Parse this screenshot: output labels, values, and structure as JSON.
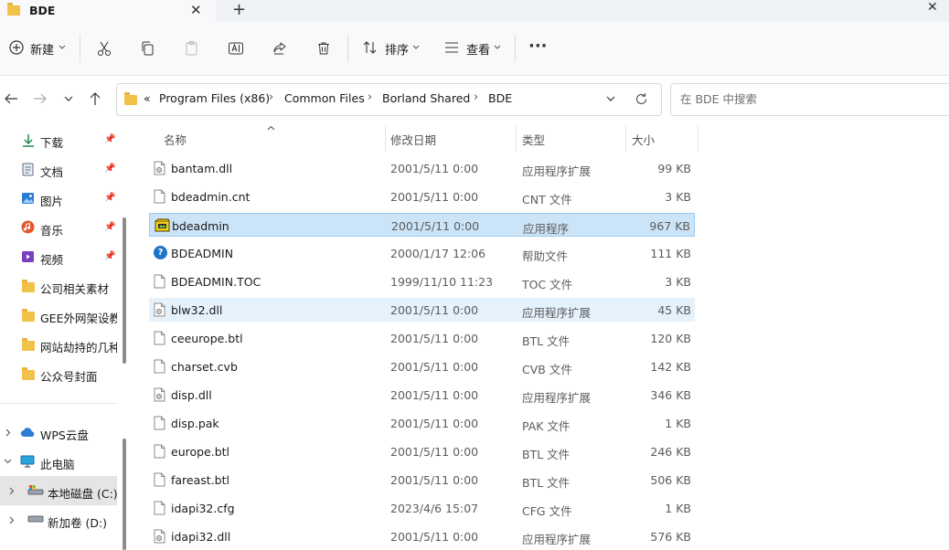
{
  "window": {
    "tab_title": "BDE",
    "tab_close": "✕",
    "new_tab": "+",
    "close": "✕"
  },
  "toolbar": {
    "new_label": "新建",
    "sort_label": "排序",
    "view_label": "查看",
    "more": "···"
  },
  "address": {
    "overflow": "«",
    "crumbs": [
      "Program Files (x86)",
      "Common Files",
      "Borland Shared",
      "BDE"
    ],
    "separator": "›"
  },
  "search": {
    "placeholder": "在 BDE 中搜索"
  },
  "sidebar": {
    "quick_access": [
      {
        "label": "下载",
        "icon": "download-icon"
      },
      {
        "label": "文档",
        "icon": "document-icon"
      },
      {
        "label": "图片",
        "icon": "picture-icon"
      },
      {
        "label": "音乐",
        "icon": "music-icon"
      },
      {
        "label": "视频",
        "icon": "video-icon"
      },
      {
        "label": "公司相关素材",
        "icon": "folder-icon"
      },
      {
        "label": "GEE外网架设教",
        "icon": "folder-icon"
      },
      {
        "label": "网站劫持的几种",
        "icon": "folder-icon"
      },
      {
        "label": "公众号封面",
        "icon": "folder-icon"
      }
    ],
    "tree": [
      {
        "label": "WPS云盘",
        "icon": "cloud-icon"
      },
      {
        "label": "此电脑",
        "icon": "computer-icon"
      },
      {
        "label": "本地磁盘 (C:)",
        "icon": "drive-icon"
      },
      {
        "label": "新加卷 (D:)",
        "icon": "drive-icon"
      }
    ]
  },
  "columns": {
    "name": "名称",
    "modified": "修改日期",
    "type": "类型",
    "size": "大小"
  },
  "files": [
    {
      "name": "bantam.dll",
      "modified": "2001/5/11 0:00",
      "type": "应用程序扩展",
      "size": "99 KB",
      "icon": "dll-file-icon"
    },
    {
      "name": "bdeadmin.cnt",
      "modified": "2001/5/11 0:00",
      "type": "CNT 文件",
      "size": "3 KB",
      "icon": "file-icon"
    },
    {
      "name": "bdeadmin",
      "modified": "2001/5/11 0:00",
      "type": "应用程序",
      "size": "967 KB",
      "icon": "app-icon"
    },
    {
      "name": "BDEADMIN",
      "modified": "2000/1/17 12:06",
      "type": "帮助文件",
      "size": "111 KB",
      "icon": "help-icon"
    },
    {
      "name": "BDEADMIN.TOC",
      "modified": "1999/11/10 11:23",
      "type": "TOC 文件",
      "size": "3 KB",
      "icon": "file-icon"
    },
    {
      "name": "blw32.dll",
      "modified": "2001/5/11 0:00",
      "type": "应用程序扩展",
      "size": "45 KB",
      "icon": "dll-file-icon"
    },
    {
      "name": "ceeurope.btl",
      "modified": "2001/5/11 0:00",
      "type": "BTL 文件",
      "size": "120 KB",
      "icon": "file-icon"
    },
    {
      "name": "charset.cvb",
      "modified": "2001/5/11 0:00",
      "type": "CVB 文件",
      "size": "142 KB",
      "icon": "file-icon"
    },
    {
      "name": "disp.dll",
      "modified": "2001/5/11 0:00",
      "type": "应用程序扩展",
      "size": "346 KB",
      "icon": "dll-file-icon"
    },
    {
      "name": "disp.pak",
      "modified": "2001/5/11 0:00",
      "type": "PAK 文件",
      "size": "1 KB",
      "icon": "file-icon"
    },
    {
      "name": "europe.btl",
      "modified": "2001/5/11 0:00",
      "type": "BTL 文件",
      "size": "246 KB",
      "icon": "file-icon"
    },
    {
      "name": "fareast.btl",
      "modified": "2001/5/11 0:00",
      "type": "BTL 文件",
      "size": "506 KB",
      "icon": "file-icon"
    },
    {
      "name": "idapi32.cfg",
      "modified": "2023/4/6 15:07",
      "type": "CFG 文件",
      "size": "1 KB",
      "icon": "file-icon"
    },
    {
      "name": "idapi32.dll",
      "modified": "2001/5/11 0:00",
      "type": "应用程序扩展",
      "size": "576 KB",
      "icon": "dll-file-icon"
    }
  ],
  "state": {
    "selected_file": "bdeadmin",
    "hovered_file": "blw32.dll",
    "selected_drive": "本地磁盘 (C:)"
  },
  "colors": {
    "selection": "#cce4f7",
    "hover": "#e5f1fb",
    "folder": "#f2c14a"
  }
}
